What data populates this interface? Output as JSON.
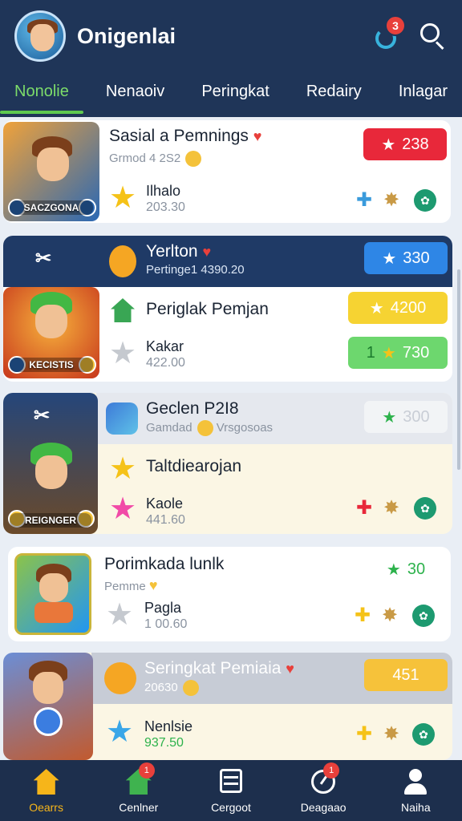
{
  "header": {
    "title": "Onigenlai",
    "notification_count": "3",
    "notification_icon": "notification-bell-icon",
    "search_icon": "search-icon"
  },
  "tabs": [
    {
      "label": "Nonolie",
      "active": true
    },
    {
      "label": "Nenaoiv",
      "active": false
    },
    {
      "label": "Peringkat",
      "active": false
    },
    {
      "label": "Redairy",
      "active": false
    },
    {
      "label": "Inlagar",
      "active": false
    }
  ],
  "cards": [
    {
      "thumb_label": "SACZGONA",
      "title": "Sasial a Pemnings",
      "subtitle": "Grmod 4 2S2",
      "badge": "238",
      "badge_color": "#e8283a",
      "name": "Ilhalo",
      "value": "203.30",
      "star_color": "#f5c218"
    },
    {
      "header_title": "Yerlton",
      "header_sub": "Pertinge1 4390.20",
      "header_badge": "330",
      "header_badge_color": "#2e86e6",
      "title": "Periglak Pemjan",
      "badge_top": "4200",
      "badge_top_color": "#f6d332",
      "badge_bottom_num": "1",
      "badge_bottom": "730",
      "badge_bottom_color": "#6dd76e",
      "thumb_label": "KECISTIS",
      "name": "Kakar",
      "value": "422.00",
      "star_color": "#c5c9cf"
    },
    {
      "header_title": "Geclen P2I8",
      "header_sub": "Gamdad",
      "header_sub2": "Vrsgosoas",
      "header_badge": "300",
      "header_badge_color": "#f2f4f6",
      "title": "Taltdiearojan",
      "thumb_label": "REIGNGER",
      "name": "Kaole",
      "value": "441.60",
      "star_color": "#f14aa7"
    },
    {
      "title": "Porimkada lunlk",
      "subtitle": "Pemme",
      "badge": "30",
      "badge_color": "#2db24c",
      "name": "Pagla",
      "value": "1 00.60",
      "star_color": "#c5c9cf"
    },
    {
      "header_title": "Seringkat Pemiaia",
      "header_sub": "20630",
      "header_badge": "451",
      "header_badge_color": "#f6c23a",
      "name": "Nenlsie",
      "value": "937.50",
      "star_color": "#39a6e8"
    }
  ],
  "bottom_nav": [
    {
      "label": "Oearrs",
      "icon": "home-icon",
      "active": true
    },
    {
      "label": "Cenlner",
      "icon": "home-green-icon",
      "active": false,
      "badge": "1"
    },
    {
      "label": "Cergoot",
      "icon": "list-icon",
      "active": false
    },
    {
      "label": "Deagaao",
      "icon": "gauge-icon",
      "active": false,
      "badge": "1"
    },
    {
      "label": "Naiha",
      "icon": "profile-icon",
      "active": false
    }
  ]
}
